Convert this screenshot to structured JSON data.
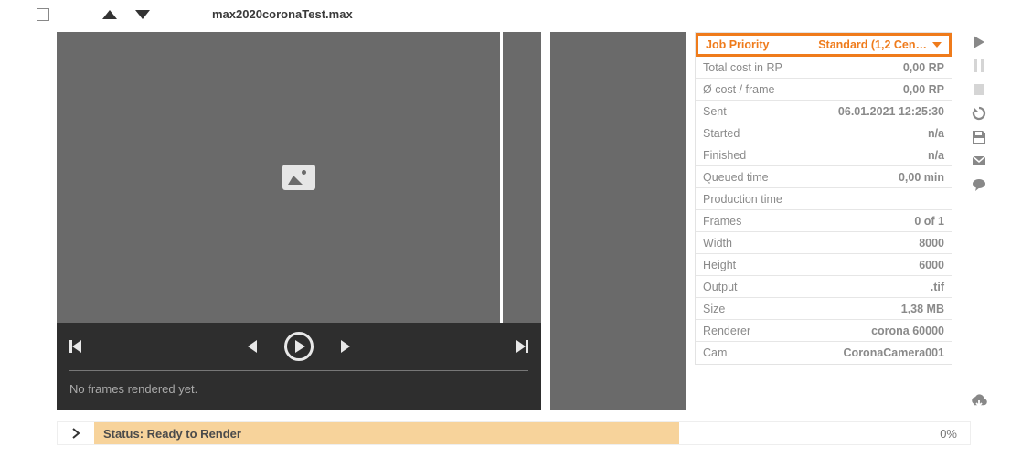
{
  "header": {
    "filename": "max2020coronaTest.max"
  },
  "player": {
    "status": "No frames rendered yet."
  },
  "info": {
    "priority": {
      "label": "Job Priority",
      "value": "Standard (1,2 Cen…"
    },
    "rows": [
      {
        "label": "Total cost in RP",
        "value": "0,00 RP"
      },
      {
        "label": "Ø cost / frame",
        "value": "0,00 RP"
      },
      {
        "label": "Sent",
        "value": "06.01.2021 12:25:30"
      },
      {
        "label": "Started",
        "value": "n/a"
      },
      {
        "label": "Finished",
        "value": "n/a"
      },
      {
        "label": "Queued time",
        "value": "0,00 min"
      },
      {
        "label": "Production time",
        "value": ""
      },
      {
        "label": "Frames",
        "value": "0 of 1"
      },
      {
        "label": "Width",
        "value": "8000"
      },
      {
        "label": "Height",
        "value": "6000"
      },
      {
        "label": "Output",
        "value": ".tif"
      },
      {
        "label": "Size",
        "value": "1,38 MB"
      },
      {
        "label": "Renderer",
        "value": "corona 60000"
      },
      {
        "label": "Cam",
        "value": "CoronaCamera001"
      }
    ]
  },
  "status": {
    "text": "Status: Ready to Render",
    "percent": "0%"
  }
}
